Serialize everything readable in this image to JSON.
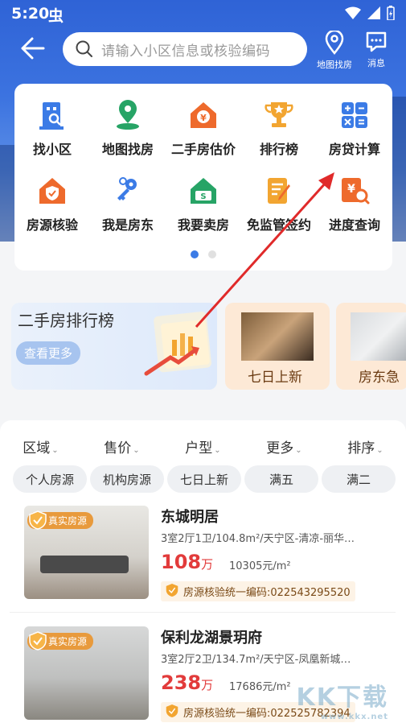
{
  "status_bar": {
    "time": "5:20",
    "app_glyph": "虫"
  },
  "header": {
    "search_placeholder": "请输入小区信息或核验编码",
    "map_button_label": "地图找房",
    "message_button_label": "消息"
  },
  "services": [
    {
      "label": "找小区",
      "icon": "building-search-icon"
    },
    {
      "label": "地图找房",
      "icon": "map-pin-icon"
    },
    {
      "label": "二手房估价",
      "icon": "house-yuan-icon"
    },
    {
      "label": "排行榜",
      "icon": "trophy-icon"
    },
    {
      "label": "房贷计算",
      "icon": "calculator-icon"
    },
    {
      "label": "房源核验",
      "icon": "house-shield-icon"
    },
    {
      "label": "我是房东",
      "icon": "keys-icon"
    },
    {
      "label": "我要卖房",
      "icon": "house-sell-icon"
    },
    {
      "label": "免监管签约",
      "icon": "contract-pen-icon"
    },
    {
      "label": "进度查询",
      "icon": "document-search-icon"
    }
  ],
  "banners": {
    "ranking": {
      "title": "二手房排行榜",
      "more": "查看更多"
    },
    "new_listings": {
      "caption": "七日上新"
    },
    "urgent": {
      "caption": "房东急"
    }
  },
  "filters": [
    "区域",
    "售价",
    "户型",
    "更多",
    "排序"
  ],
  "quick_tags": [
    "个人房源",
    "机构房源",
    "七日上新",
    "满五",
    "满二"
  ],
  "listings": [
    {
      "badge": "真实房源",
      "name": "东城明居",
      "details": "3室2厅1卫/104.8m²/天宁区-清凉-丽华…",
      "price": "108",
      "price_unit": "万",
      "unit_price": "10305元/m²",
      "verify_code": "房源核验统一编码:022543295520"
    },
    {
      "badge": "真实房源",
      "name": "保利龙湖景玥府",
      "details": "3室2厅2卫/134.7m²/天宁区-凤凰新城…",
      "price": "238",
      "price_unit": "万",
      "unit_price": "17686元/m²",
      "verify_code": "房源核验统一编码:022525782394"
    }
  ],
  "watermark": {
    "main": "KK下载",
    "sub": "www.kkx.net"
  },
  "colors": {
    "brand_blue": "#3b7be6",
    "price_red": "#e23b3b",
    "badge_orange": "#e89a3c"
  }
}
